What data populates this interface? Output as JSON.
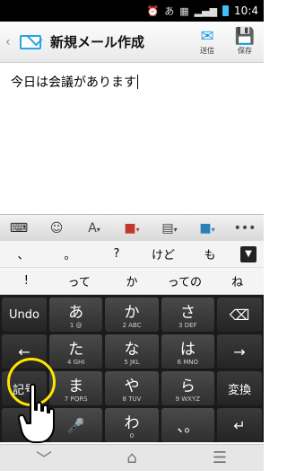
{
  "status_bar": {
    "time": "10:4",
    "ime_indicator": "あ"
  },
  "app_bar": {
    "title": "新規メール作成",
    "send_label": "送信",
    "save_label": "保存"
  },
  "editor": {
    "text": "今日は会議があります"
  },
  "candidates": {
    "row1": [
      "、",
      "。",
      "?",
      "けど",
      "も"
    ],
    "row2": [
      "!",
      "って",
      "か",
      "っての",
      "ね"
    ]
  },
  "keyboard": {
    "rows": [
      {
        "left": "Undo",
        "keys": [
          {
            "main": "あ",
            "sub": "1 @"
          },
          {
            "main": "か",
            "sub": "2 ABC"
          },
          {
            "main": "さ",
            "sub": "3 DEF"
          }
        ],
        "right": "⌫"
      },
      {
        "left": "←",
        "keys": [
          {
            "main": "た",
            "sub": "4 GHI"
          },
          {
            "main": "な",
            "sub": "5 JKL"
          },
          {
            "main": "は",
            "sub": "6 MNO"
          }
        ],
        "right": "→"
      },
      {
        "left": "記号",
        "keys": [
          {
            "main": "ま",
            "sub": "7 PQRS"
          },
          {
            "main": "や",
            "sub": "8 TUV"
          },
          {
            "main": "ら",
            "sub": "9 WXYZ"
          }
        ],
        "right": "変換"
      },
      {
        "left": "",
        "keys": [
          {
            "main": "🎤",
            "sub": ""
          },
          {
            "main": "わ",
            "sub": "0"
          },
          {
            "main": "、。",
            "sub": ""
          }
        ],
        "right": "↵"
      }
    ]
  },
  "colors": {
    "accent": "#1f9ee8",
    "highlight": "#ffe600"
  }
}
